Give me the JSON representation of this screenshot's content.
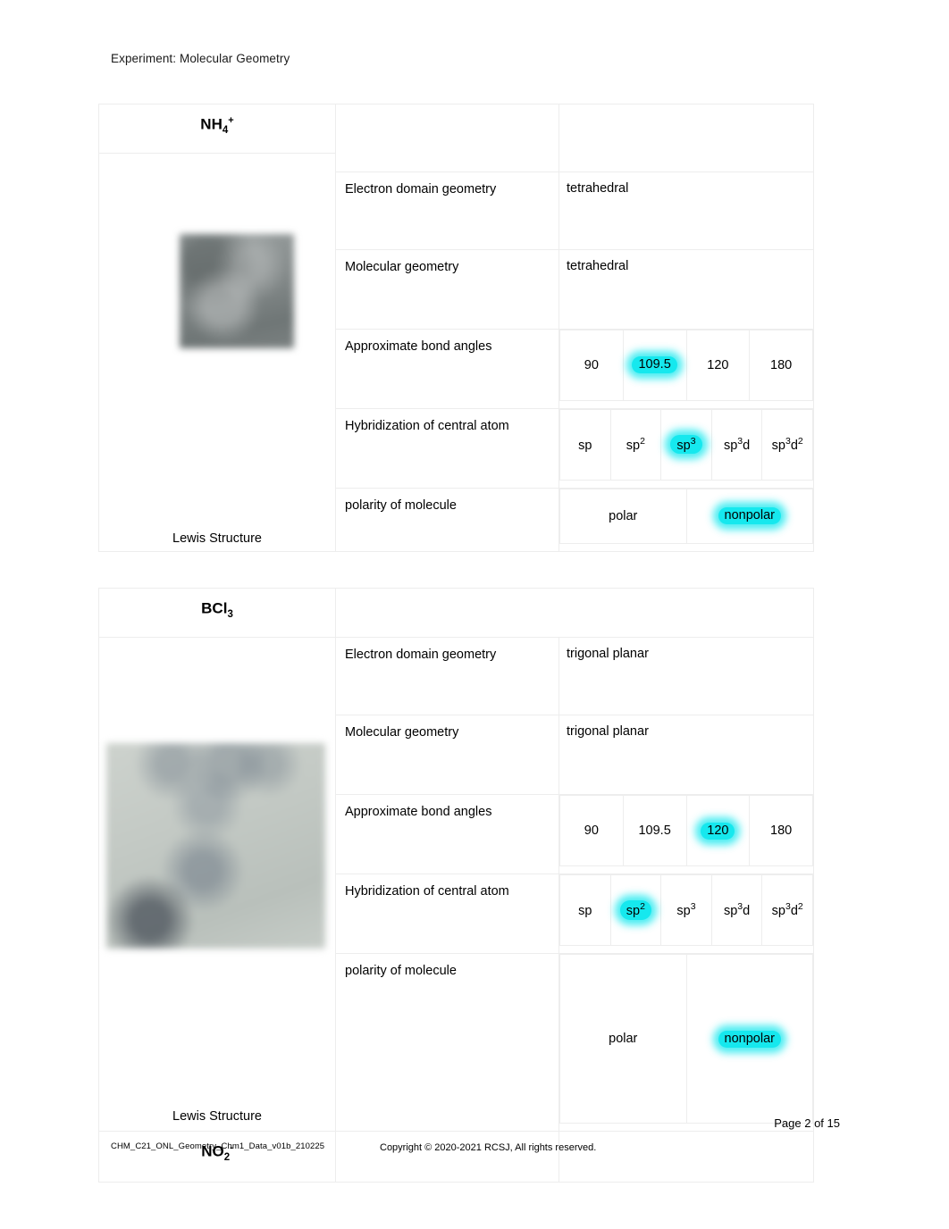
{
  "document": {
    "header": "Experiment: Molecular Geometry",
    "footer": {
      "page_label": "Page 2 of 15",
      "file_code": "CHM_C21_ONL_Geometry_Chm1_Data_v01b_210225",
      "copyright": "Copyright © 2020-2021 RCSJ, All rights reserved."
    }
  },
  "colors": {
    "highlight": "#16E8EE",
    "border": "#EDEDED",
    "text": "#000000"
  },
  "labels": {
    "electron_domain_geometry": "Electron domain geometry",
    "molecular_geometry": "Molecular geometry",
    "bond_angles": "Approximate bond angles",
    "hybridization": "Hybridization of central atom",
    "polarity": "polarity of molecule",
    "lewis_structure": "Lewis Structure"
  },
  "tables": [
    {
      "formula_main": "NH",
      "formula_sub": "4",
      "formula_sup": "+",
      "electron_domain_geometry": "tetrahedral",
      "molecular_geometry": "tetrahedral",
      "bond_angle_options": [
        "90",
        "109.5",
        "120",
        "180"
      ],
      "bond_angle_selected": "109.5",
      "hybridization_options": [
        {
          "base": "sp",
          "sup": "",
          "base2": "",
          "sup2": ""
        },
        {
          "base": "sp",
          "sup": "2",
          "base2": "",
          "sup2": ""
        },
        {
          "base": "sp",
          "sup": "3",
          "base2": "",
          "sup2": ""
        },
        {
          "base": "sp",
          "sup": "3",
          "base2": "d",
          "sup2": ""
        },
        {
          "base": "sp",
          "sup": "3",
          "base2": "d",
          "sup2": "2"
        }
      ],
      "hybridization_selected_index": 2,
      "polarity_options": [
        "polar",
        "nonpolar"
      ],
      "polarity_selected": "nonpolar"
    },
    {
      "formula_main": "BCl",
      "formula_sub": "3",
      "formula_sup": "",
      "electron_domain_geometry": "trigonal planar",
      "molecular_geometry": "trigonal planar",
      "bond_angle_options": [
        "90",
        "109.5",
        "120",
        "180"
      ],
      "bond_angle_selected": "120",
      "hybridization_options": [
        {
          "base": "sp",
          "sup": "",
          "base2": "",
          "sup2": ""
        },
        {
          "base": "sp",
          "sup": "2",
          "base2": "",
          "sup2": ""
        },
        {
          "base": "sp",
          "sup": "3",
          "base2": "",
          "sup2": ""
        },
        {
          "base": "sp",
          "sup": "3",
          "base2": "d",
          "sup2": ""
        },
        {
          "base": "sp",
          "sup": "3",
          "base2": "d",
          "sup2": "2"
        }
      ],
      "hybridization_selected_index": 1,
      "polarity_options": [
        "polar",
        "nonpolar"
      ],
      "polarity_selected": "nonpolar"
    }
  ],
  "next_table": {
    "formula_main": "NO",
    "formula_sub": "2",
    "formula_sup": "-"
  }
}
